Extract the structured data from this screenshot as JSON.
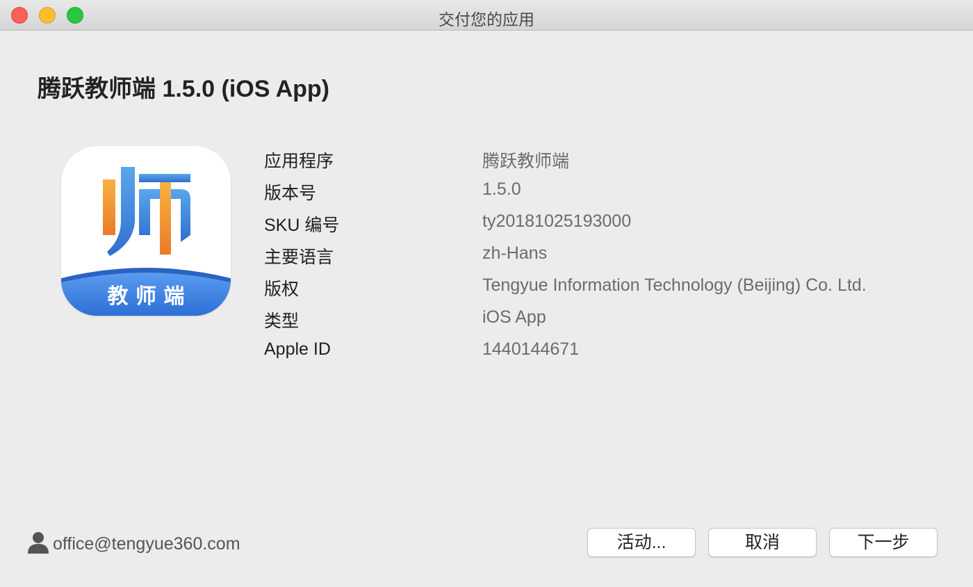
{
  "window": {
    "title": "交付您的应用"
  },
  "app": {
    "heading": "腾跃教师端 1.5.0 (iOS App)",
    "icon": {
      "name": "teacher-app-icon",
      "main_glyph": "师",
      "banner_text": "教 师 端",
      "colors": {
        "orange": "#f08a2c",
        "blue": "#3b7fd9",
        "banner": "#3f86e6"
      }
    }
  },
  "info": [
    {
      "label": "应用程序",
      "value": "腾跃教师端"
    },
    {
      "label": "版本号",
      "value": "1.5.0"
    },
    {
      "label": "SKU 编号",
      "value": "ty20181025193000"
    },
    {
      "label": "主要语言",
      "value": "zh-Hans"
    },
    {
      "label": "版权",
      "value": "Tengyue Information Technology (Beijing) Co. Ltd."
    },
    {
      "label": "类型",
      "value": "iOS App"
    },
    {
      "label": "Apple ID",
      "value": "1440144671"
    }
  ],
  "account": {
    "icon": "user-icon",
    "email": "office@tengyue360.com"
  },
  "buttons": {
    "activity": "活动...",
    "cancel": "取消",
    "next": "下一步"
  }
}
